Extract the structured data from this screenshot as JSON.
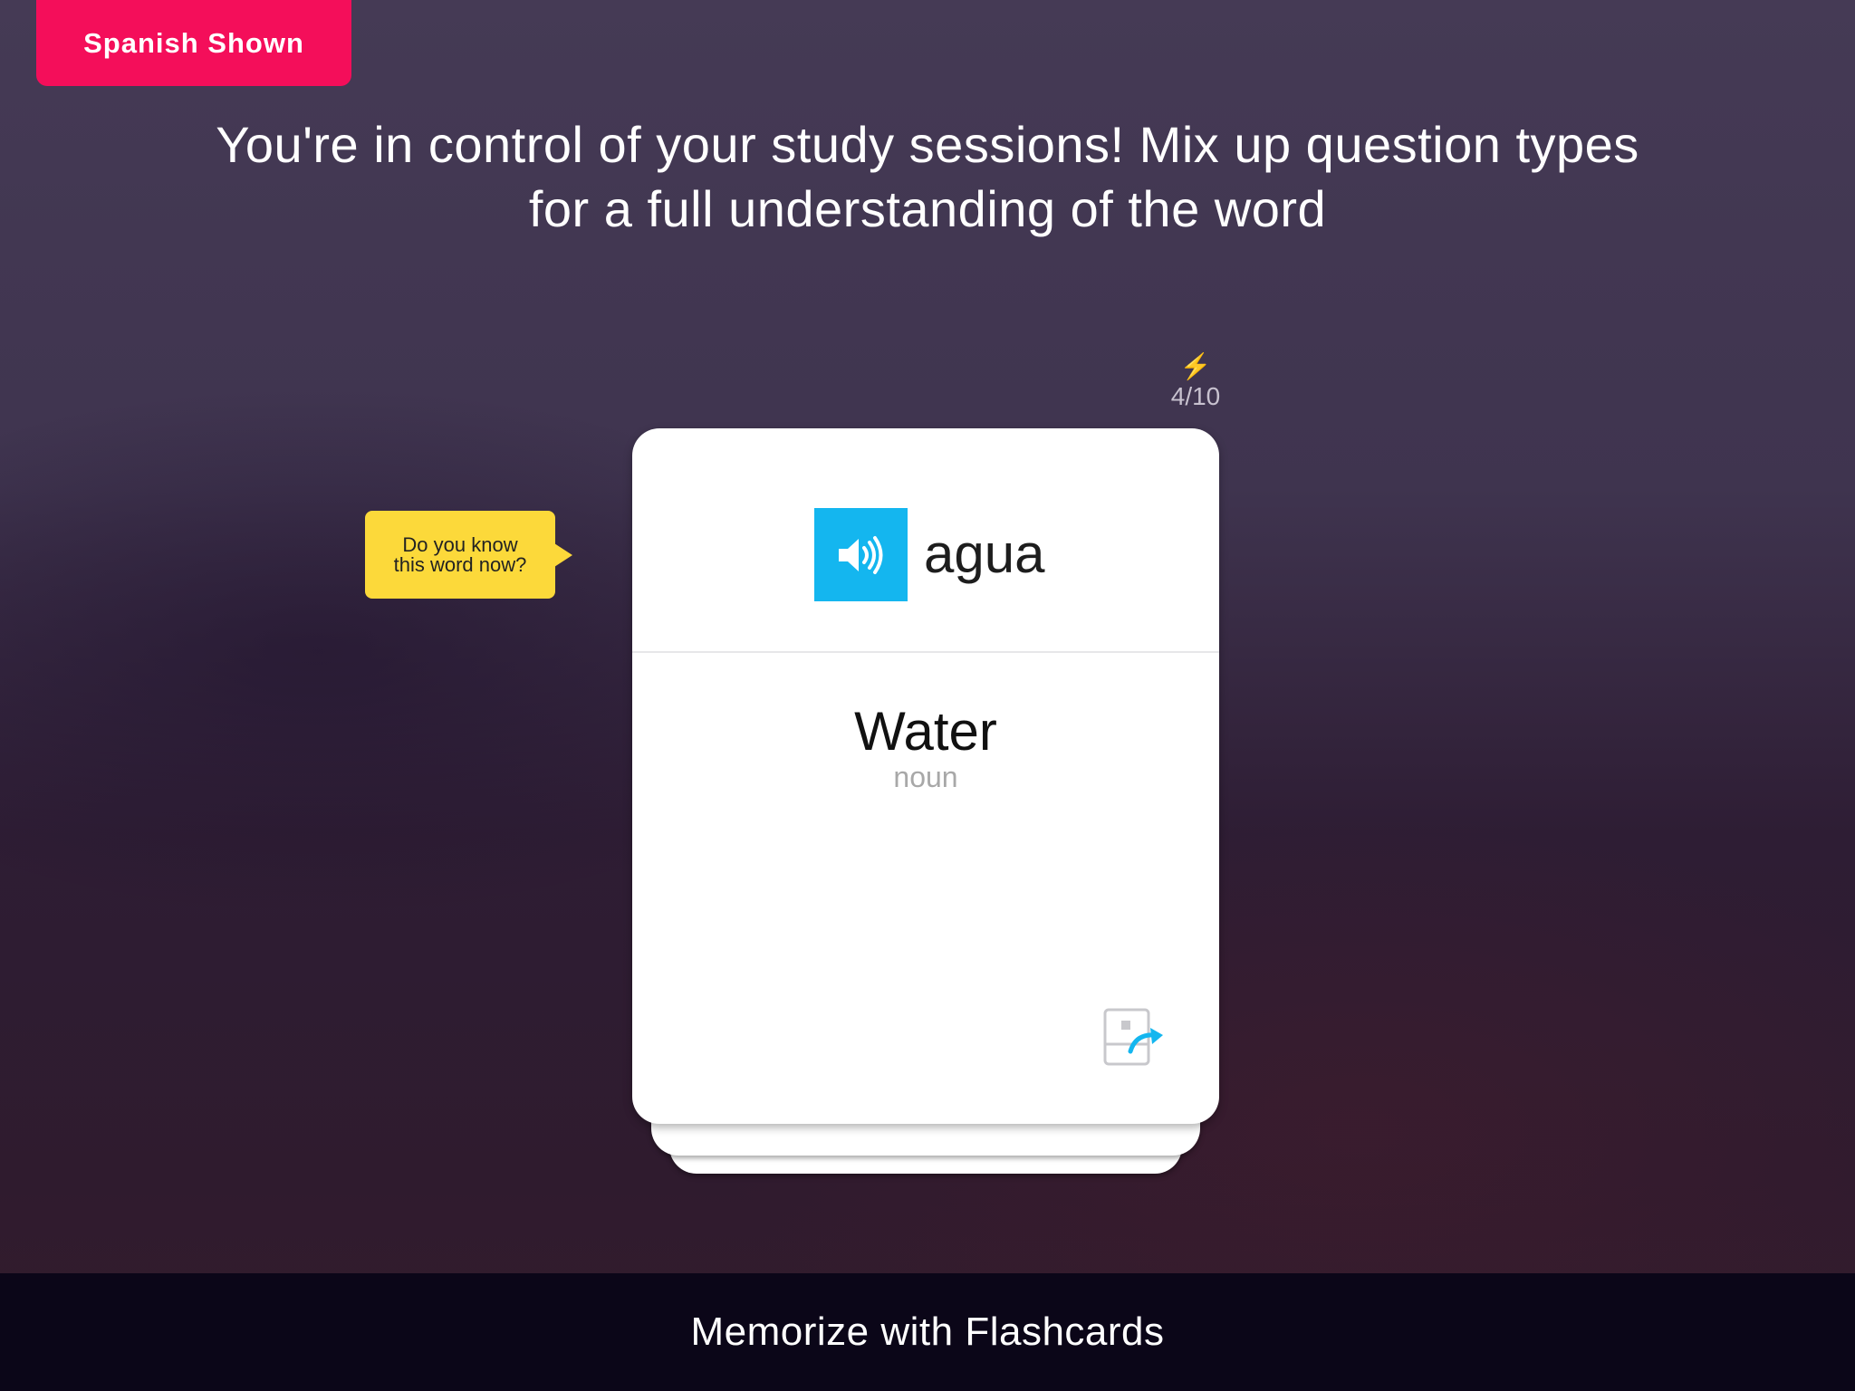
{
  "mode_badge": {
    "label": "Spanish Shown"
  },
  "headline": {
    "line1": "You're in control of your study sessions! Mix up question types",
    "line2": "for a full understanding of the word"
  },
  "progress": {
    "icon": "lightning-icon",
    "glyph": "⚡",
    "count": "4/10"
  },
  "tooltip": {
    "line1": "Do you know",
    "line2": "this word now?"
  },
  "flashcard": {
    "word": "agua",
    "translation": "Water",
    "part_of_speech": "noun",
    "audio_icon": "speaker-icon",
    "flip_icon": "flip-card-icon"
  },
  "footer": {
    "caption": "Memorize with Flashcards"
  },
  "colors": {
    "badge": "#f40e5a",
    "audio_button": "#14b6ef",
    "tooltip": "#fcd93a",
    "footer": "#0b0618"
  }
}
